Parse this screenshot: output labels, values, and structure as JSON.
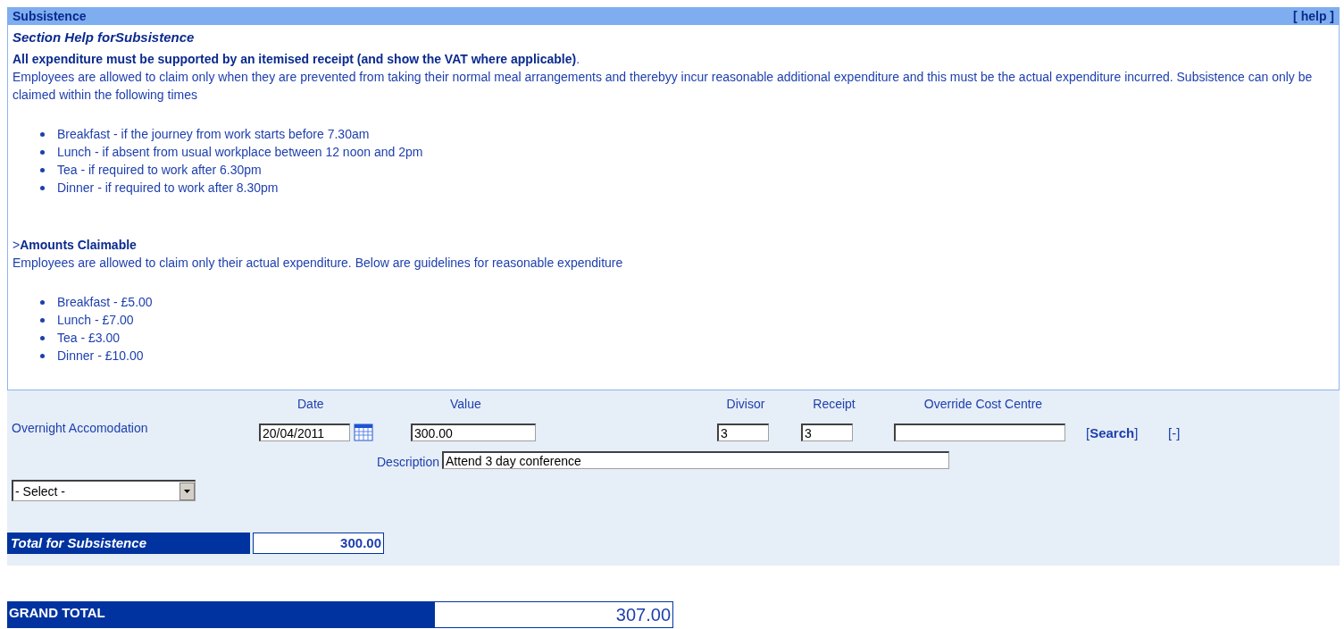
{
  "section": {
    "title": "Subsistence",
    "help_link": "[ help ]"
  },
  "help": {
    "heading": "Section Help forSubsistence",
    "notice": "**All expenditure must be supported by an itemised receipt (and show the VAT where applicable)**.",
    "paragraph": "Employees are allowed to claim only when they are prevented from taking their normal meal arrangements and therebyy incur reasonable additional expenditure and this must be the actual expenditure incurred. Subsistence can only be claimed within the following times",
    "times": [
      "Breakfast - if the journey from work starts before 7.30am",
      "Lunch - if absent from usual workplace between 12 noon and 2pm",
      "Tea - if required to work after 6.30pm",
      "Dinner - if required to work after 8.30pm"
    ],
    "amounts_heading": ">**Amounts Claimable**",
    "amounts_paragraph": "Employees are allowed to claim only their actual expenditure. Below are guidelines for reasonable expenditure",
    "amounts": [
      "Breakfast - £5.00",
      "Lunch - £7.00",
      "Tea - £3.00",
      "Dinner - £10.00"
    ]
  },
  "form": {
    "columns": {
      "date": "Date",
      "value": "Value",
      "divisor": "Divisor",
      "receipt": "Receipt",
      "override": "Override Cost Centre"
    },
    "item": {
      "label": "Overnight Accomodation",
      "date": "20/04/2011",
      "value": "300.00",
      "divisor": "3",
      "receipt": "3",
      "search_link": "[**Search**]",
      "remove_link": "[-]",
      "description_label": "Description",
      "description": "Attend 3 day conference"
    },
    "select": "- Select -"
  },
  "total": {
    "label": "Total for Subsistence",
    "value": "300.00"
  },
  "grand_total": {
    "label": "GRAND TOTAL",
    "value": "307.00"
  }
}
